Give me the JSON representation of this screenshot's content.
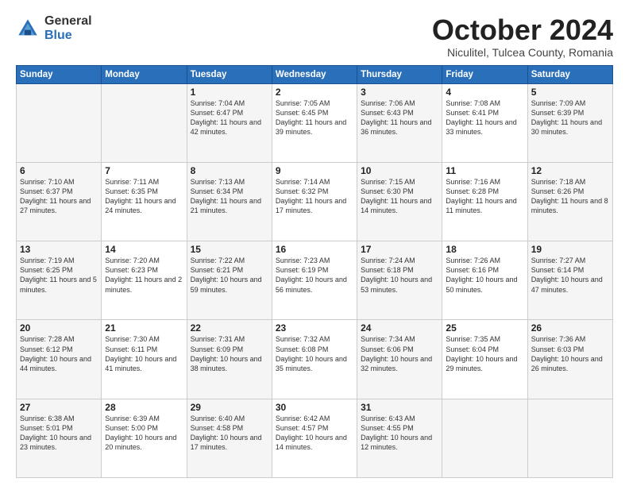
{
  "header": {
    "logo_general": "General",
    "logo_blue": "Blue",
    "month_title": "October 2024",
    "subtitle": "Niculitel, Tulcea County, Romania"
  },
  "days_of_week": [
    "Sunday",
    "Monday",
    "Tuesday",
    "Wednesday",
    "Thursday",
    "Friday",
    "Saturday"
  ],
  "weeks": [
    [
      {
        "day": "",
        "sunrise": "",
        "sunset": "",
        "daylight": ""
      },
      {
        "day": "",
        "sunrise": "",
        "sunset": "",
        "daylight": ""
      },
      {
        "day": "1",
        "sunrise": "Sunrise: 7:04 AM",
        "sunset": "Sunset: 6:47 PM",
        "daylight": "Daylight: 11 hours and 42 minutes."
      },
      {
        "day": "2",
        "sunrise": "Sunrise: 7:05 AM",
        "sunset": "Sunset: 6:45 PM",
        "daylight": "Daylight: 11 hours and 39 minutes."
      },
      {
        "day": "3",
        "sunrise": "Sunrise: 7:06 AM",
        "sunset": "Sunset: 6:43 PM",
        "daylight": "Daylight: 11 hours and 36 minutes."
      },
      {
        "day": "4",
        "sunrise": "Sunrise: 7:08 AM",
        "sunset": "Sunset: 6:41 PM",
        "daylight": "Daylight: 11 hours and 33 minutes."
      },
      {
        "day": "5",
        "sunrise": "Sunrise: 7:09 AM",
        "sunset": "Sunset: 6:39 PM",
        "daylight": "Daylight: 11 hours and 30 minutes."
      }
    ],
    [
      {
        "day": "6",
        "sunrise": "Sunrise: 7:10 AM",
        "sunset": "Sunset: 6:37 PM",
        "daylight": "Daylight: 11 hours and 27 minutes."
      },
      {
        "day": "7",
        "sunrise": "Sunrise: 7:11 AM",
        "sunset": "Sunset: 6:35 PM",
        "daylight": "Daylight: 11 hours and 24 minutes."
      },
      {
        "day": "8",
        "sunrise": "Sunrise: 7:13 AM",
        "sunset": "Sunset: 6:34 PM",
        "daylight": "Daylight: 11 hours and 21 minutes."
      },
      {
        "day": "9",
        "sunrise": "Sunrise: 7:14 AM",
        "sunset": "Sunset: 6:32 PM",
        "daylight": "Daylight: 11 hours and 17 minutes."
      },
      {
        "day": "10",
        "sunrise": "Sunrise: 7:15 AM",
        "sunset": "Sunset: 6:30 PM",
        "daylight": "Daylight: 11 hours and 14 minutes."
      },
      {
        "day": "11",
        "sunrise": "Sunrise: 7:16 AM",
        "sunset": "Sunset: 6:28 PM",
        "daylight": "Daylight: 11 hours and 11 minutes."
      },
      {
        "day": "12",
        "sunrise": "Sunrise: 7:18 AM",
        "sunset": "Sunset: 6:26 PM",
        "daylight": "Daylight: 11 hours and 8 minutes."
      }
    ],
    [
      {
        "day": "13",
        "sunrise": "Sunrise: 7:19 AM",
        "sunset": "Sunset: 6:25 PM",
        "daylight": "Daylight: 11 hours and 5 minutes."
      },
      {
        "day": "14",
        "sunrise": "Sunrise: 7:20 AM",
        "sunset": "Sunset: 6:23 PM",
        "daylight": "Daylight: 11 hours and 2 minutes."
      },
      {
        "day": "15",
        "sunrise": "Sunrise: 7:22 AM",
        "sunset": "Sunset: 6:21 PM",
        "daylight": "Daylight: 10 hours and 59 minutes."
      },
      {
        "day": "16",
        "sunrise": "Sunrise: 7:23 AM",
        "sunset": "Sunset: 6:19 PM",
        "daylight": "Daylight: 10 hours and 56 minutes."
      },
      {
        "day": "17",
        "sunrise": "Sunrise: 7:24 AM",
        "sunset": "Sunset: 6:18 PM",
        "daylight": "Daylight: 10 hours and 53 minutes."
      },
      {
        "day": "18",
        "sunrise": "Sunrise: 7:26 AM",
        "sunset": "Sunset: 6:16 PM",
        "daylight": "Daylight: 10 hours and 50 minutes."
      },
      {
        "day": "19",
        "sunrise": "Sunrise: 7:27 AM",
        "sunset": "Sunset: 6:14 PM",
        "daylight": "Daylight: 10 hours and 47 minutes."
      }
    ],
    [
      {
        "day": "20",
        "sunrise": "Sunrise: 7:28 AM",
        "sunset": "Sunset: 6:12 PM",
        "daylight": "Daylight: 10 hours and 44 minutes."
      },
      {
        "day": "21",
        "sunrise": "Sunrise: 7:30 AM",
        "sunset": "Sunset: 6:11 PM",
        "daylight": "Daylight: 10 hours and 41 minutes."
      },
      {
        "day": "22",
        "sunrise": "Sunrise: 7:31 AM",
        "sunset": "Sunset: 6:09 PM",
        "daylight": "Daylight: 10 hours and 38 minutes."
      },
      {
        "day": "23",
        "sunrise": "Sunrise: 7:32 AM",
        "sunset": "Sunset: 6:08 PM",
        "daylight": "Daylight: 10 hours and 35 minutes."
      },
      {
        "day": "24",
        "sunrise": "Sunrise: 7:34 AM",
        "sunset": "Sunset: 6:06 PM",
        "daylight": "Daylight: 10 hours and 32 minutes."
      },
      {
        "day": "25",
        "sunrise": "Sunrise: 7:35 AM",
        "sunset": "Sunset: 6:04 PM",
        "daylight": "Daylight: 10 hours and 29 minutes."
      },
      {
        "day": "26",
        "sunrise": "Sunrise: 7:36 AM",
        "sunset": "Sunset: 6:03 PM",
        "daylight": "Daylight: 10 hours and 26 minutes."
      }
    ],
    [
      {
        "day": "27",
        "sunrise": "Sunrise: 6:38 AM",
        "sunset": "Sunset: 5:01 PM",
        "daylight": "Daylight: 10 hours and 23 minutes."
      },
      {
        "day": "28",
        "sunrise": "Sunrise: 6:39 AM",
        "sunset": "Sunset: 5:00 PM",
        "daylight": "Daylight: 10 hours and 20 minutes."
      },
      {
        "day": "29",
        "sunrise": "Sunrise: 6:40 AM",
        "sunset": "Sunset: 4:58 PM",
        "daylight": "Daylight: 10 hours and 17 minutes."
      },
      {
        "day": "30",
        "sunrise": "Sunrise: 6:42 AM",
        "sunset": "Sunset: 4:57 PM",
        "daylight": "Daylight: 10 hours and 14 minutes."
      },
      {
        "day": "31",
        "sunrise": "Sunrise: 6:43 AM",
        "sunset": "Sunset: 4:55 PM",
        "daylight": "Daylight: 10 hours and 12 minutes."
      },
      {
        "day": "",
        "sunrise": "",
        "sunset": "",
        "daylight": ""
      },
      {
        "day": "",
        "sunrise": "",
        "sunset": "",
        "daylight": ""
      }
    ]
  ]
}
